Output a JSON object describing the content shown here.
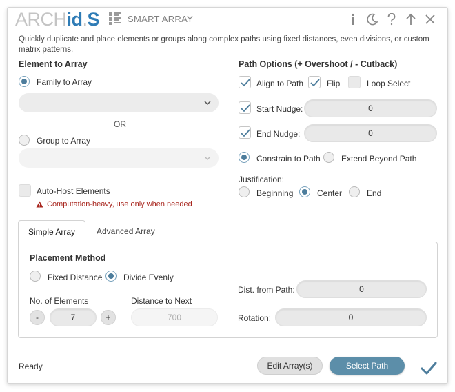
{
  "app": {
    "logo_parts": [
      "ARCH",
      "id",
      ".",
      "S"
    ],
    "title": "SMART ARRAY",
    "description": "Quickly duplicate and place elements or groups along complex paths using fixed distances, even divisions, or custom matrix patterns."
  },
  "titlebar_icons": [
    "info-icon",
    "theme-moon-icon",
    "help-icon",
    "collapse-up-icon",
    "close-icon"
  ],
  "element_section": {
    "title": "Element to Array",
    "family_label": "Family to Array",
    "family_selected": true,
    "family_value": "",
    "or_label": "OR",
    "group_label": "Group to Array",
    "group_selected": false,
    "group_value": "",
    "autohost_label": "Auto-Host Elements",
    "autohost_checked": false,
    "warning": "Computation-heavy, use only when needed"
  },
  "path_section": {
    "title": "Path Options (+ Overshoot / - Cutback)",
    "align_label": "Align to Path",
    "align_checked": true,
    "flip_label": "Flip",
    "flip_checked": true,
    "loop_label": "Loop Select",
    "loop_checked": false,
    "start_nudge_label": "Start Nudge:",
    "start_nudge_value": "0",
    "end_nudge_label": "End Nudge:",
    "end_nudge_value": "0",
    "constrain_label": "Constrain to Path",
    "extend_label": "Extend Beyond Path",
    "path_mode": "constrain",
    "justification_label": "Justification:",
    "justification_options": [
      "Beginning",
      "Center",
      "End"
    ],
    "justification_selected": "Center"
  },
  "tabs": [
    {
      "label": "Simple Array",
      "active": true
    },
    {
      "label": "Advanced Array",
      "active": false
    }
  ],
  "simple_array": {
    "placement_title": "Placement Method",
    "fixed_label": "Fixed Distance",
    "divide_label": "Divide Evenly",
    "placement_selected": "Divide Evenly",
    "elements_label": "No. of Elements",
    "minus_label": "-",
    "elements_value": "7",
    "plus_label": "+",
    "distance_label": "Distance to Next",
    "distance_value": "700",
    "dist_from_path_label": "Dist. from Path:",
    "dist_from_path_value": "0",
    "rotation_label": "Rotation:",
    "rotation_value": "0"
  },
  "footer": {
    "status": "Ready.",
    "edit_button": "Edit Array(s)",
    "select_button": "Select Path"
  },
  "colors": {
    "accent": "#5c8ea9",
    "logo_blue": "#2f7cb6",
    "warning_red": "#a8261e"
  }
}
